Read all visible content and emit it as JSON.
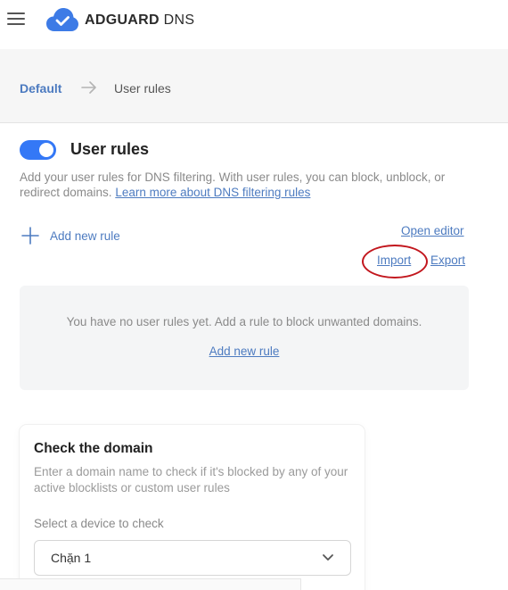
{
  "header": {
    "brand_bold": "ADGUARD",
    "brand_light": "DNS"
  },
  "breadcrumb": {
    "parent": "Default",
    "current": "User rules"
  },
  "user_rules": {
    "enabled": true,
    "title": "User rules",
    "description": "Add your user rules for DNS filtering. With user rules, you can block, unblock, or redirect domains.",
    "learn_more_link": "Learn more about DNS filtering rules",
    "add_new_rule": "Add new rule",
    "open_editor": "Open editor",
    "import": "Import",
    "export": "Export",
    "empty_message": "You have no user rules yet. Add a rule to block unwanted domains.",
    "empty_add_link": "Add new rule"
  },
  "check_domain": {
    "title": "Check the domain",
    "description": "Enter a domain name to check if it's blocked by any of your active blocklists or custom user rules",
    "device_label": "Select a device to check",
    "device_selected": "Chặn 1"
  },
  "colors": {
    "accent": "#3478f6",
    "link": "#4d7bc0",
    "annotation": "#c2161d"
  },
  "icons": {
    "menu": "hamburger-icon",
    "logo": "cloud-shield-icon",
    "breadcrumb_separator": "arrow-right-icon",
    "add": "plus-icon",
    "select": "chevron-down-icon"
  }
}
